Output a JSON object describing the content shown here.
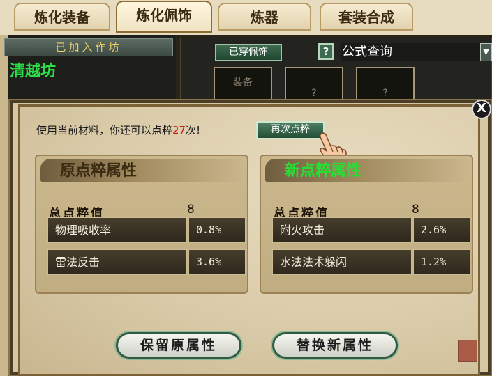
{
  "tabs": [
    {
      "label": "炼化装备"
    },
    {
      "label": "炼化佩饰"
    },
    {
      "label": "炼器"
    },
    {
      "label": "套装合成"
    }
  ],
  "left_panel": {
    "joined_label": "已加入作坊",
    "workshop_name": "清越坊",
    "workshop_color": "#2ce04a"
  },
  "right_panel": {
    "equipped_button": "已穿佩饰",
    "help_label": "?",
    "formula_label": "公式查询",
    "slots": [
      {
        "label": "装备"
      },
      {
        "label": "?"
      },
      {
        "label": "?"
      }
    ]
  },
  "dialog": {
    "close_label": "X",
    "prompt_before": "使用当前材料，你还可以点粹",
    "remaining_count": "27",
    "prompt_after": "次!",
    "repeat_button": "再次点粹",
    "old_attributes": {
      "title": "原点粹属性",
      "total_label": "总点粹值",
      "total_value": "8",
      "rows": [
        {
          "name": "物理吸收率",
          "value": "0.8%"
        },
        {
          "name": "雷法反击",
          "value": "3.6%"
        }
      ]
    },
    "new_attributes": {
      "title": "新点粹属性",
      "total_label": "总点粹值",
      "total_value": "8",
      "rows": [
        {
          "name": "附火攻击",
          "value": "2.6%"
        },
        {
          "name": "水法法术躲闪",
          "value": "1.2%"
        }
      ]
    },
    "keep_button": "保留原属性",
    "replace_button": "替换新属性"
  },
  "colors": {
    "highlight_count": "#d01818",
    "new_title": "#23e033",
    "button_green": "#2f5b40"
  },
  "icons": [
    "pointing-hand-icon",
    "close-icon",
    "dropdown-arrow-icon",
    "seal-stamp-icon"
  ]
}
